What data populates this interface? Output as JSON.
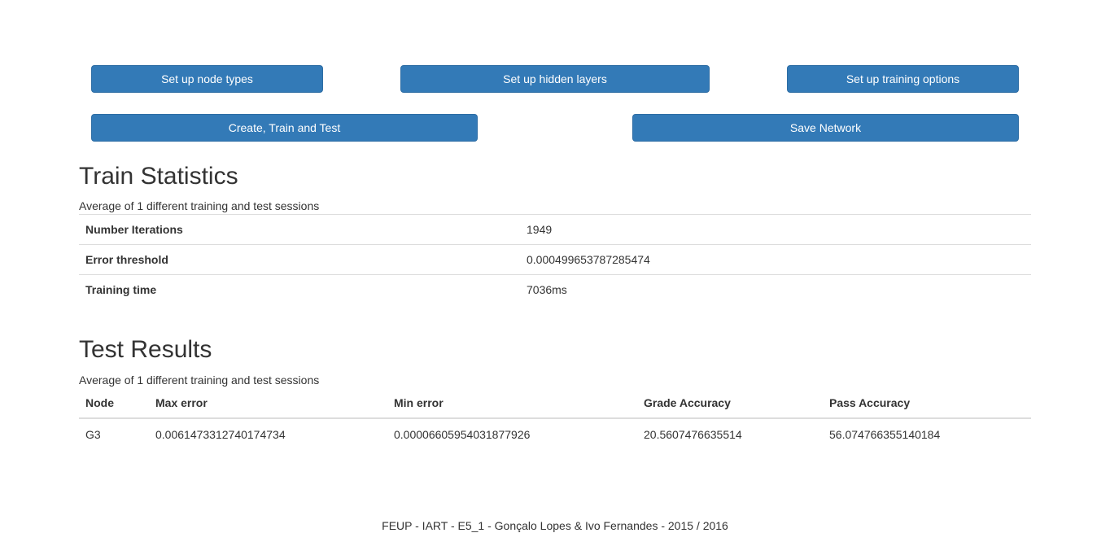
{
  "toolbar": {
    "node_types_label": "Set up node types",
    "hidden_layers_label": "Set up hidden layers",
    "training_options_label": "Set up training options",
    "create_train_test_label": "Create, Train and Test",
    "save_network_label": "Save Network"
  },
  "train_statistics": {
    "title": "Train Statistics",
    "subtitle": "Average of 1 different training and test sessions",
    "rows": [
      {
        "label": "Number Iterations",
        "value": "1949"
      },
      {
        "label": "Error threshold",
        "value": "0.000499653787285474"
      },
      {
        "label": "Training time",
        "value": "7036ms"
      }
    ]
  },
  "test_results": {
    "title": "Test Results",
    "subtitle": "Average of 1 different training and test sessions",
    "columns": [
      "Node",
      "Max error",
      "Min error",
      "Grade Accuracy",
      "Pass Accuracy"
    ],
    "rows": [
      {
        "node": "G3",
        "max_error": "0.0061473312740174734",
        "min_error": "0.00006605954031877926",
        "grade_accuracy": "20.5607476635514",
        "pass_accuracy": "56.074766355140184"
      }
    ]
  },
  "footer": {
    "text": "FEUP - IART - E5_1 - Gonçalo Lopes & Ivo Fernandes - 2015 / 2016"
  },
  "colors": {
    "primary_button": "#337ab7",
    "primary_button_border": "#2e6da4",
    "text": "#333333",
    "table_border": "#dddddd"
  }
}
